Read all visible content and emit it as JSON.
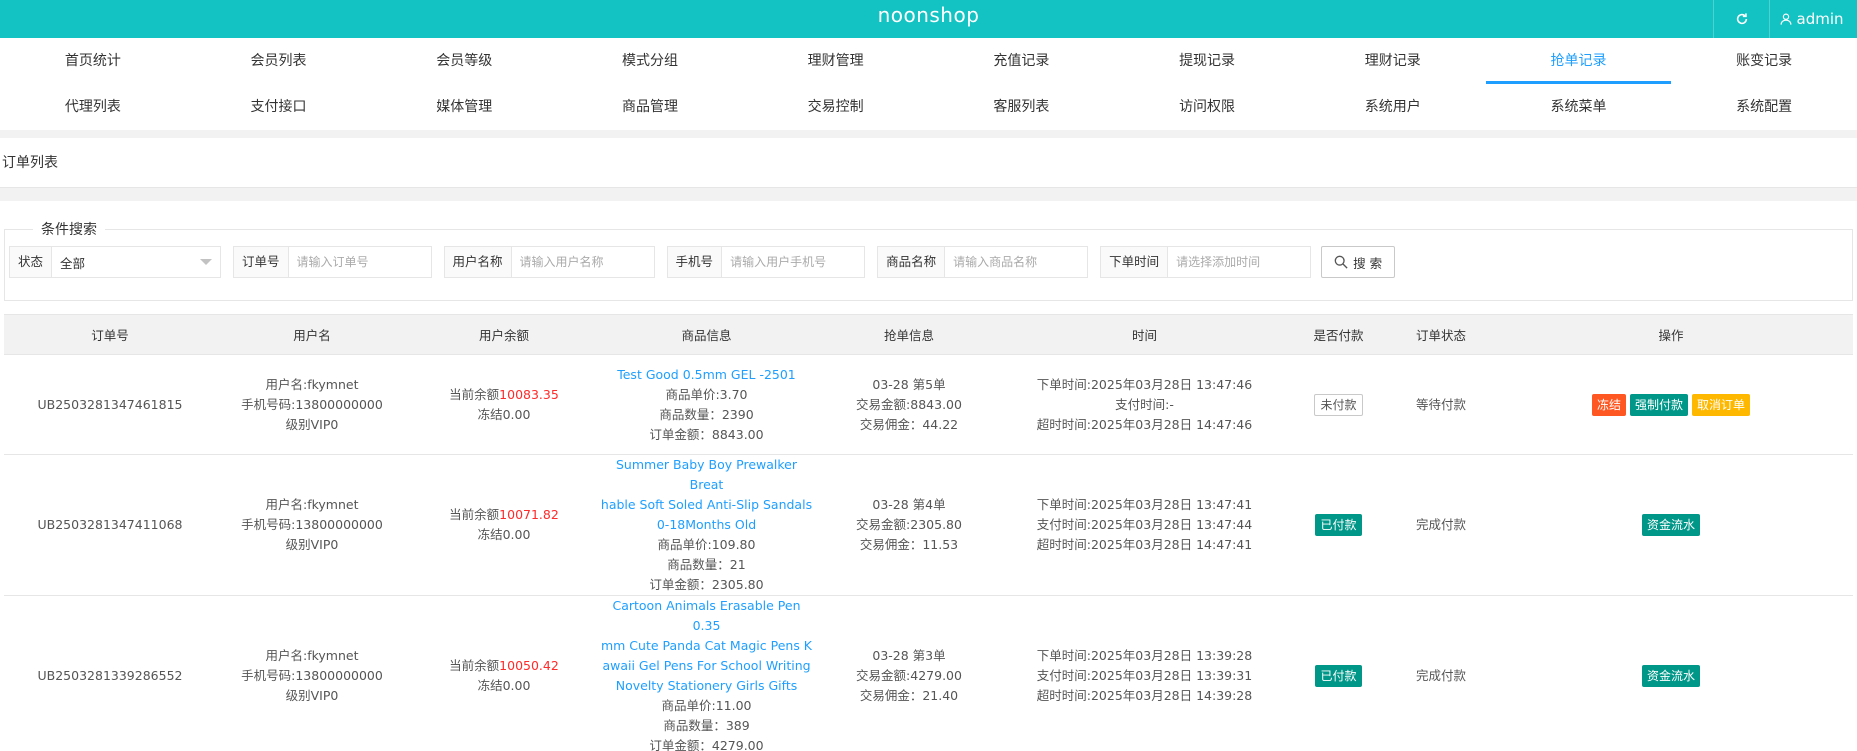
{
  "header": {
    "brand": "noonshop",
    "user": "admin",
    "refresh_icon": "refresh-icon",
    "user_icon": "user-icon",
    "color": "#13c2c2"
  },
  "nav": {
    "row1": [
      "首页统计",
      "会员列表",
      "会员等级",
      "模式分组",
      "理财管理",
      "充值记录",
      "提现记录",
      "理财记录",
      "抢单记录",
      "账变记录"
    ],
    "row2": [
      "代理列表",
      "支付接口",
      "媒体管理",
      "商品管理",
      "交易控制",
      "客服列表",
      "访问权限",
      "系统用户",
      "系统菜单",
      "系统配置"
    ],
    "active": "抢单记录",
    "active_color": "#1e9fff"
  },
  "page": {
    "title": "订单列表"
  },
  "search": {
    "legend": "条件搜索",
    "status": {
      "label": "状态",
      "value": "全部"
    },
    "order_no": {
      "label": "订单号",
      "placeholder": "请输入订单号"
    },
    "username": {
      "label": "用户名称",
      "placeholder": "请输入用户名称"
    },
    "phone": {
      "label": "手机号",
      "placeholder": "请输入用户手机号"
    },
    "goods": {
      "label": "商品名称",
      "placeholder": "请输入商品名称"
    },
    "time": {
      "label": "下单时间",
      "placeholder": "请选择添加时间"
    },
    "button": "搜 索"
  },
  "table": {
    "headers": [
      "订单号",
      "用户名",
      "用户余额",
      "商品信息",
      "抢单信息",
      "时间",
      "是否付款",
      "订单状态",
      "操作"
    ],
    "rows": [
      {
        "order_no": "UB2503281347461815",
        "user": {
          "name": "用户名:fkymnet",
          "phone": "手机号码:13800000000",
          "level": "级别VIP0"
        },
        "balance": {
          "prefix": "当前余额",
          "value": "10083.35",
          "frozen": "冻结0.00"
        },
        "goods": {
          "name_lines": [
            "Test Good 0.5mm GEL -2501"
          ],
          "price": "商品单价:3.70",
          "qty": "商品数量：2390",
          "total": "订单金额：8843.00"
        },
        "grab": {
          "line1": "03-28 第5单",
          "line2": "交易金额:8843.00",
          "line3": "交易佣金：44.22"
        },
        "time": {
          "order": "下单时间:2025年03月28日 13:47:46",
          "pay": "支付时间:-",
          "expire": "超时时间:2025年03月28日 14:47:46"
        },
        "paid": "未付款",
        "status": "等待付款",
        "actions": [
          "冻结",
          "强制付款",
          "取消订单"
        ]
      },
      {
        "order_no": "UB2503281347411068",
        "user": {
          "name": "用户名:fkymnet",
          "phone": "手机号码:13800000000",
          "level": "级别VIP0"
        },
        "balance": {
          "prefix": "当前余额",
          "value": "10071.82",
          "frozen": "冻结0.00"
        },
        "goods": {
          "name_lines": [
            "Summer Baby Boy Prewalker Breat",
            "hable Soft Soled Anti-Slip Sandals",
            "0-18Months Old"
          ],
          "price": "商品单价:109.80",
          "qty": "商品数量：21",
          "total": "订单金额：2305.80"
        },
        "grab": {
          "line1": "03-28 第4单",
          "line2": "交易金额:2305.80",
          "line3": "交易佣金：11.53"
        },
        "time": {
          "order": "下单时间:2025年03月28日 13:47:41",
          "pay": "支付时间:2025年03月28日 13:47:44",
          "expire": "超时时间:2025年03月28日 14:47:41"
        },
        "paid": "已付款",
        "status": "完成付款",
        "actions": [
          "资金流水"
        ]
      },
      {
        "order_no": "UB2503281339286552",
        "user": {
          "name": "用户名:fkymnet",
          "phone": "手机号码:13800000000",
          "level": "级别VIP0"
        },
        "balance": {
          "prefix": "当前余额",
          "value": "10050.42",
          "frozen": "冻结0.00"
        },
        "goods": {
          "name_lines": [
            "Cartoon Animals Erasable Pen 0.35",
            "mm Cute Panda Cat Magic Pens K",
            "awaii Gel Pens For School Writing",
            "Novelty Stationery Girls Gifts"
          ],
          "price": "商品单价:11.00",
          "qty": "商品数量：389",
          "total": "订单金额：4279.00"
        },
        "grab": {
          "line1": "03-28 第3单",
          "line2": "交易金额:4279.00",
          "line3": "交易佣金：21.40"
        },
        "time": {
          "order": "下单时间:2025年03月28日 13:39:28",
          "pay": "支付时间:2025年03月28日 13:39:31",
          "expire": "超时时间:2025年03月28日 14:39:28"
        },
        "paid": "已付款",
        "status": "完成付款",
        "actions": [
          "资金流水"
        ]
      }
    ]
  }
}
